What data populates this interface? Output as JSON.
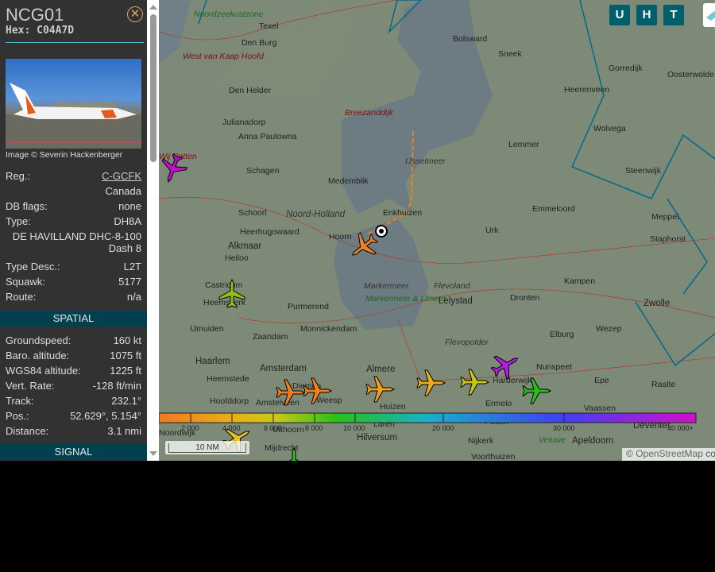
{
  "aircraft": {
    "callsign": "NCG01",
    "hex": "Hex: C04A7D",
    "photo_credit": "Image © Severin Hackenberger",
    "rows": [
      {
        "label": "Reg.:",
        "value": "C-GCFK"
      },
      {
        "label": "",
        "value": "Canada"
      },
      {
        "label": "DB flags:",
        "value": "none"
      },
      {
        "label": "Type:",
        "value": "DH8A"
      },
      {
        "label": "",
        "value": "DE HAVILLAND DHC-8-100 Dash 8"
      },
      {
        "label": "Type Desc.:",
        "value": "L2T"
      },
      {
        "label": "Squawk:",
        "value": "5177"
      },
      {
        "label": "Route:",
        "value": "n/a"
      }
    ]
  },
  "spatial": {
    "title": "SPATIAL",
    "rows": [
      {
        "label": "Groundspeed:",
        "value": "160 kt"
      },
      {
        "label": "Baro. altitude:",
        "value": "1075 ft"
      },
      {
        "label": "WGS84 altitude:",
        "value": "1225 ft"
      },
      {
        "label": "Vert. Rate:",
        "value": "-128 ft/min"
      },
      {
        "label": "Track:",
        "value": "232.1°"
      },
      {
        "label": "Pos.:",
        "value": "52.629°, 5.154°"
      },
      {
        "label": "Distance:",
        "value": "3.1 nmi"
      }
    ]
  },
  "signal": {
    "title": "SIGNAL"
  },
  "map_buttons": [
    "U",
    "H",
    "T"
  ],
  "map_labels": [
    "Noordzeekustzone",
    "Texel",
    "Den Burg",
    "West van Kaap Hoofd",
    "Den Helder",
    "Julianadorp",
    "Anna Paulowna",
    "Breezanddijk",
    "Bolsward",
    "Sneek",
    "Gorredijk",
    "Oosterwolde",
    "Heerenveen",
    "Wolvega",
    "Lemmer",
    "Steenwijk",
    "IJsselmeer",
    "Schagen",
    "Medemblik",
    "Noord-Holland",
    "Enkhuizen",
    "Emmeloord",
    "Meppel",
    "Schoorl",
    "Heerhugowaard",
    "Hoorn",
    "Urk",
    "Staphorst",
    "Alkmaar",
    "Heiloo",
    "Castricum",
    "Heemskerk",
    "Markermeer",
    "Flevoland",
    "Markermeer & IJmeer",
    "Lelystad",
    "Dronten",
    "Kampen",
    "Zwolle",
    "Purmerend",
    "IJmuiden",
    "Monnickendam",
    "Zaandam",
    "Flevopolder",
    "Elburg",
    "Wezep",
    "Haarlem",
    "Amsterdam",
    "Almere",
    "Nunspeet",
    "Harderwijk",
    "Heemstede",
    "Ermelo",
    "Epe",
    "Raalte",
    "Hoofddorp",
    "Amstelveen",
    "Diemen",
    "Weesp",
    "Huizen",
    "Vaassen",
    "Hilversum",
    "Laren",
    "Putten",
    "Deventer",
    "Nijkerk",
    "Veluwe",
    "Apeldoorn",
    "Mijdrecht",
    "Uithoorn",
    "Voorthuizen",
    "Noordwijk",
    "Wij Petten"
  ],
  "altitude_legend": {
    "ticks": [
      "2 000",
      "4 000",
      "6 000",
      "8 000",
      "10 000",
      "20 000",
      "30 000",
      "40 000+"
    ]
  },
  "scale_label": "10 NM",
  "attribution": {
    "prefix": "© ",
    "link": "OpenStreetMap",
    "suffix": " co"
  },
  "colors": {
    "panel": "#323232",
    "section": "#00404f",
    "button": "#005f6b",
    "selected_track": "#f08020"
  }
}
